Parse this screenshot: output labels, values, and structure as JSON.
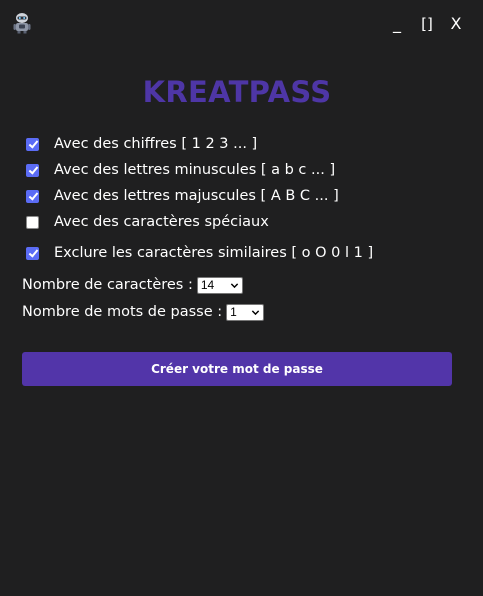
{
  "window": {
    "controls": {
      "minimize": "_",
      "maximize": "[]",
      "close": "X"
    }
  },
  "app": {
    "title": "KREATPASS"
  },
  "options": [
    {
      "label": "Avec des chiffres [ 1 2 3 ... ]",
      "checked": true
    },
    {
      "label": "Avec des lettres minuscules [ a b c ... ]",
      "checked": true
    },
    {
      "label": "Avec des lettres majuscules [ A B C ... ]",
      "checked": true
    },
    {
      "label": "Avec des caractères spéciaux",
      "checked": false
    },
    {
      "label": "Exclure les caractères similaires [ o O 0 l 1 ]",
      "checked": true
    }
  ],
  "settings": {
    "length_label": "Nombre de caractères :",
    "length_value": "14",
    "count_label": "Nombre de mots de passe :",
    "count_value": "1"
  },
  "actions": {
    "create_label": "Créer votre mot de passe"
  },
  "colors": {
    "background": "#1f1f20",
    "title": "#4e36a6",
    "button": "#5235a9",
    "checkbox": "#5b6cf5"
  }
}
